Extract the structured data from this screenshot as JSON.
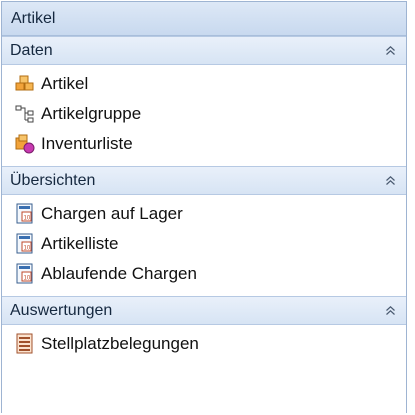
{
  "panel": {
    "title": "Artikel"
  },
  "sections": [
    {
      "header": "Daten",
      "items": [
        {
          "label": "Artikel",
          "icon": "boxes-icon"
        },
        {
          "label": "Artikelgruppe",
          "icon": "hierarchy-icon"
        },
        {
          "label": "Inventurliste",
          "icon": "inventory-icon"
        }
      ]
    },
    {
      "header": "Übersichten",
      "items": [
        {
          "label": "Chargen auf Lager",
          "icon": "calendar-report-icon"
        },
        {
          "label": "Artikelliste",
          "icon": "calendar-report-icon"
        },
        {
          "label": "Ablaufende Chargen",
          "icon": "calendar-report-icon"
        }
      ]
    },
    {
      "header": "Auswertungen",
      "items": [
        {
          "label": "Stellplatzbelegungen",
          "icon": "report-list-icon"
        }
      ]
    }
  ],
  "colors": {
    "header_text": "#15283f",
    "border": "#9eb4d2",
    "accent": "#f0a030"
  }
}
